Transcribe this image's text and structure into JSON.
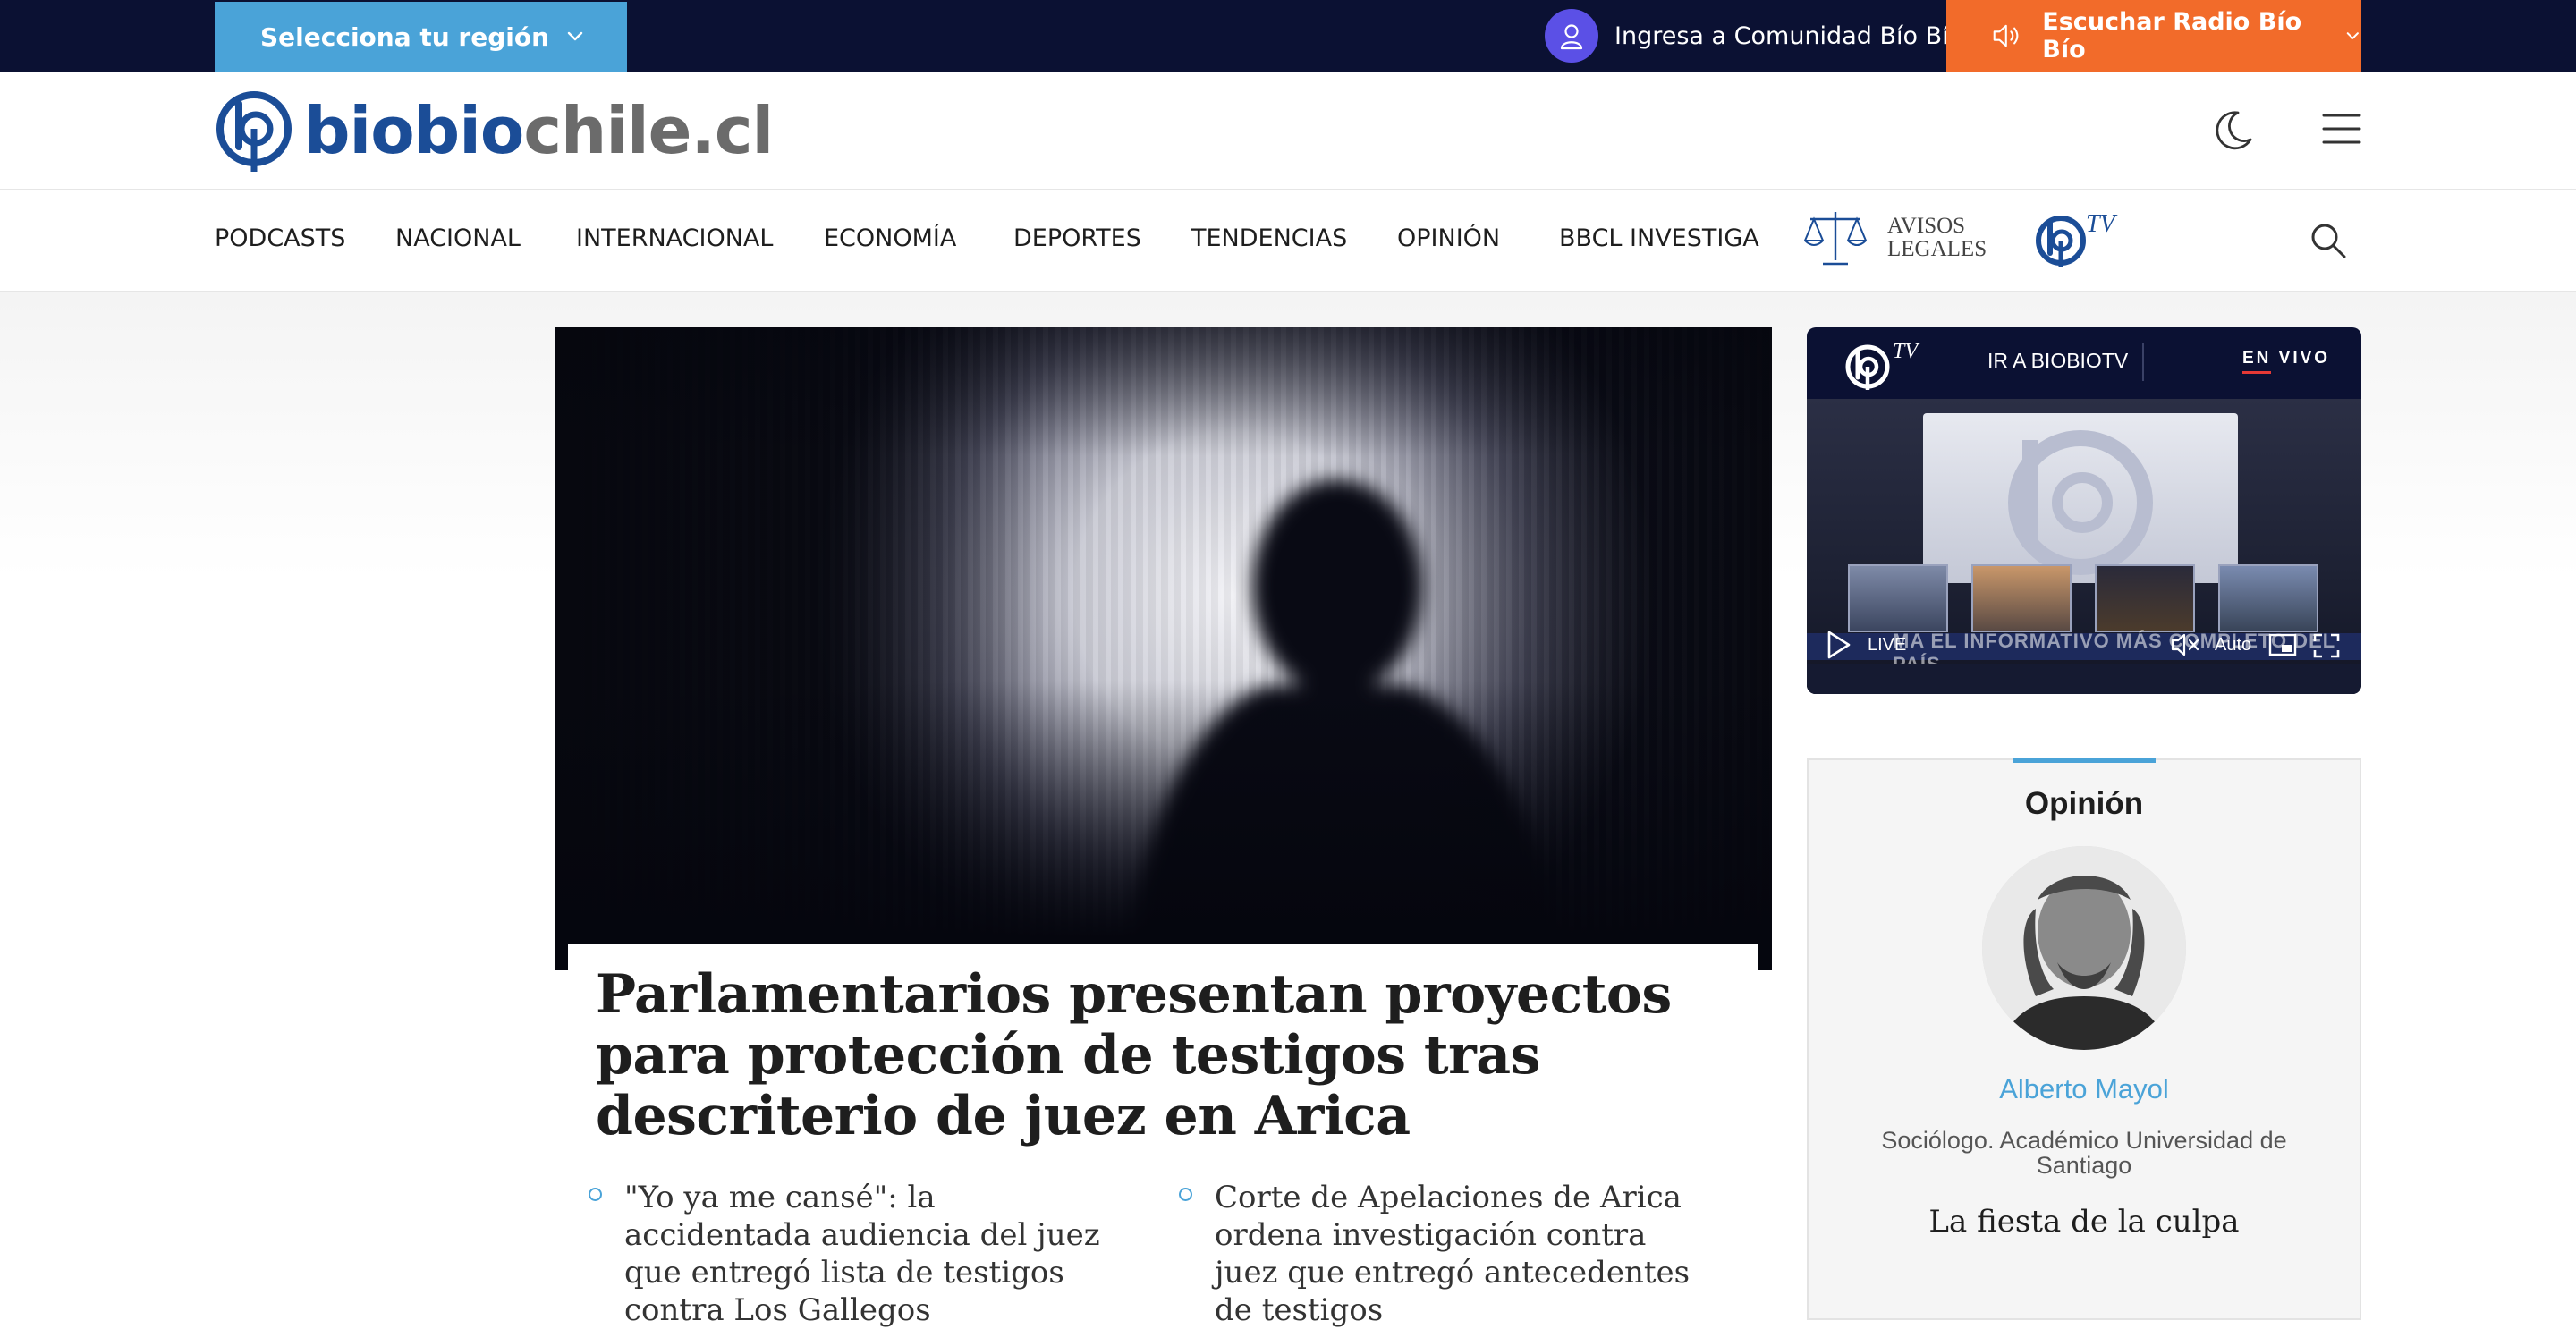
{
  "topbar": {
    "region_label": "Selecciona tu región",
    "community_label": "Ingresa a Comunidad Bío Bío",
    "radio_label": "Escuchar Radio Bío Bío"
  },
  "header": {
    "logo_part1": "biobio",
    "logo_part2": "chile.cl"
  },
  "nav": {
    "items": [
      "PODCASTS",
      "NACIONAL",
      "INTERNACIONAL",
      "ECONOMÍA",
      "DEPORTES",
      "TENDENCIAS",
      "OPINIÓN",
      "BBCL INVESTIGA"
    ],
    "avisos_line1": "AVISOS",
    "avisos_line2": "LEGALES",
    "tv_label": "TV"
  },
  "main": {
    "headline": "Parlamentarios presentan proyectos para protección de testigos tras descriterio de juez en Arica",
    "related": [
      "\"Yo ya me cansé\": la accidentada audiencia del juez que entregó lista de testigos contra Los Gallegos",
      "Corte de Apelaciones de Arica ordena investigación contra juez que entregó antecedentes de testigos"
    ]
  },
  "tv": {
    "tv_label": "TV",
    "ir_label": "IR A BIOBIOTV",
    "live_label": "EN VIVO",
    "player_live": "LIVE",
    "player_quality": "Auto",
    "ticker_text": "MA   EL INFORMATIVO MÁS COMPLETO DEL PAÍS"
  },
  "opinion": {
    "section_title": "Opinión",
    "author_name": "Alberto Mayol",
    "author_role": "Sociólogo. Académico Universidad de Santiago",
    "article_title": "La fiesta de la culpa"
  },
  "colors": {
    "topbar_bg": "#0b1133",
    "region_btn": "#4aa3d8",
    "radio_btn": "#f26b2a",
    "brand_blue": "#1b4d97",
    "accent_blue": "#4aa3d8",
    "community_avatar": "#5b50e6"
  }
}
